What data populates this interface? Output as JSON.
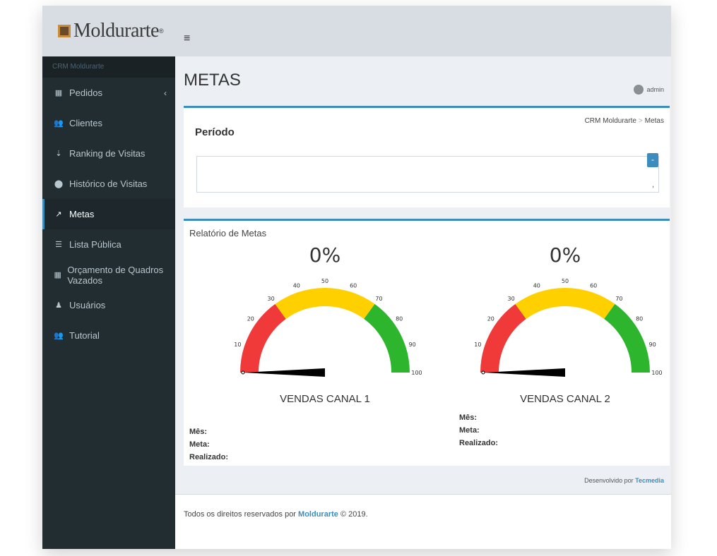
{
  "brand": {
    "name": "Moldurarte",
    "reg": "®"
  },
  "header": {
    "menu_icon": "≡",
    "user": "admin"
  },
  "sidebar": {
    "title": "CRM Moldurarte",
    "items": [
      {
        "label": "Pedidos",
        "icon": "grid-icon"
      },
      {
        "label": "Clientes",
        "icon": "users-icon"
      },
      {
        "label": "Ranking de Visitas",
        "icon": "sort-icon"
      },
      {
        "label": "Histórico de Visitas",
        "icon": "map-marker-icon"
      },
      {
        "label": "Metas",
        "icon": "line-chart-icon"
      },
      {
        "label": "Lista Pública",
        "icon": "list-icon"
      },
      {
        "label": "Orçamento de Quadros Vazados",
        "icon": "grid-icon"
      },
      {
        "label": "Usuários",
        "icon": "user-icon"
      },
      {
        "label": "Tutorial",
        "icon": "users-icon"
      }
    ],
    "active": "Metas"
  },
  "page": {
    "title": "METAS"
  },
  "breadcrumb": {
    "root": "CRM Moldurarte",
    "current": "Metas"
  },
  "periodo": {
    "title": "Período",
    "collapse": "-",
    "input_value": ","
  },
  "relatorio": {
    "title": "Relatório de Metas",
    "gauges": [
      {
        "value": "0%",
        "name": "VENDAS CANAL 1",
        "percent": 0
      },
      {
        "value": "0%",
        "name": "VENDAS CANAL 2",
        "percent": 0
      }
    ],
    "ticks": [
      "10",
      "20",
      "30",
      "40",
      "50",
      "60",
      "70",
      "80",
      "90",
      "100"
    ],
    "colors": {
      "red": "#f03a3a",
      "yellow": "#ffd000",
      "green": "#2db52d"
    },
    "stats_labels": {
      "mes": "Mês:",
      "meta": "Meta:",
      "realizado": "Realizado:"
    }
  },
  "footer": {
    "credit_prefix": "Desenvolvido por",
    "credit_name": "Tecmedia",
    "rights_prefix": "Todos os direitos reservados por",
    "rights_name": "Moldurarte",
    "rights_suffix": "© 2019."
  }
}
